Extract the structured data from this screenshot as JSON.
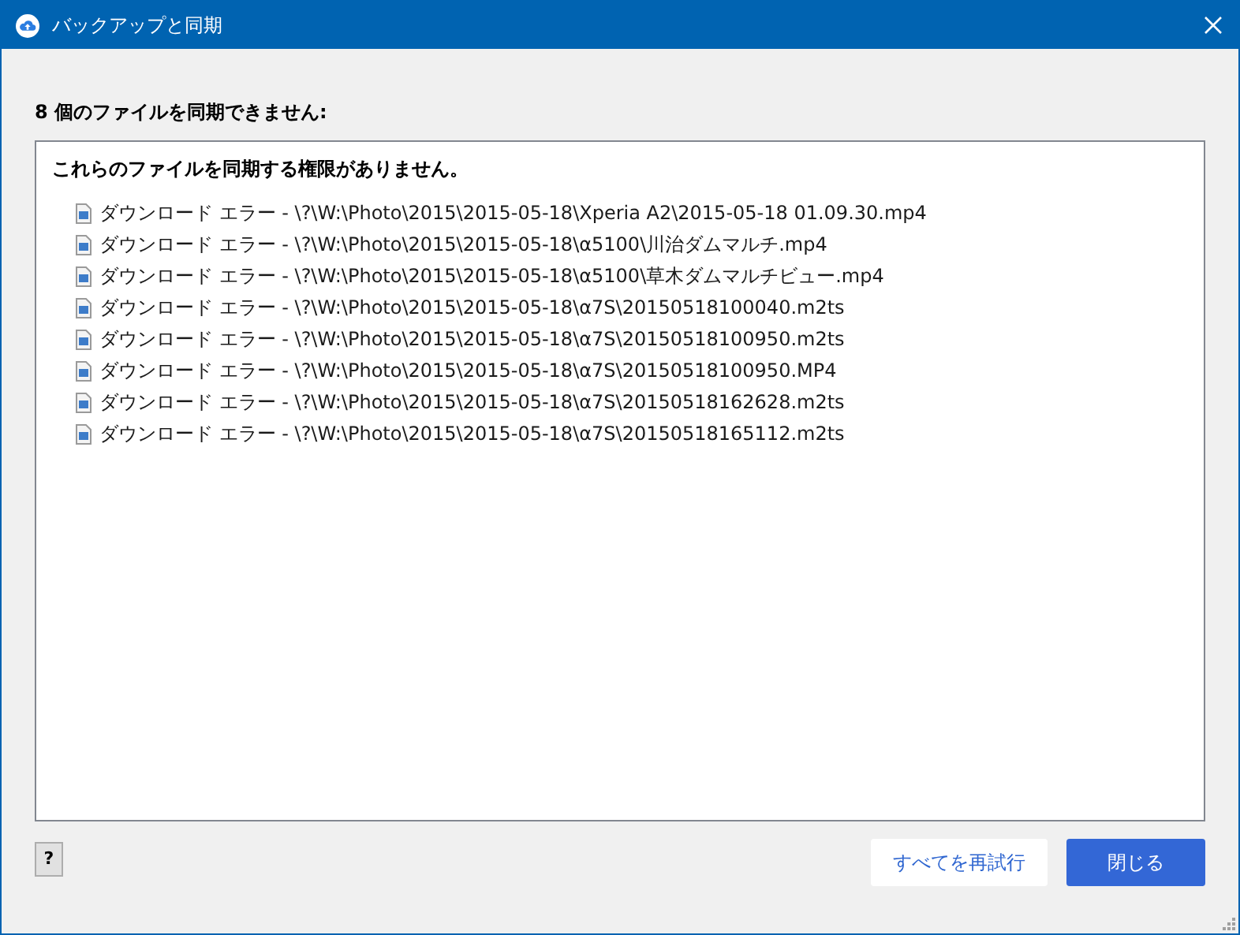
{
  "window": {
    "title": "バックアップと同期"
  },
  "heading": "8 個のファイルを同期できません:",
  "panel": {
    "message": "これらのファイルを同期する権限がありません。",
    "items": [
      "ダウンロード エラー - \\?\\W:\\Photo\\2015\\2015-05-18\\Xperia A2\\2015-05-18 01.09.30.mp4",
      "ダウンロード エラー - \\?\\W:\\Photo\\2015\\2015-05-18\\α5100\\川治ダムマルチ.mp4",
      "ダウンロード エラー - \\?\\W:\\Photo\\2015\\2015-05-18\\α5100\\草木ダムマルチビュー.mp4",
      "ダウンロード エラー - \\?\\W:\\Photo\\2015\\2015-05-18\\α7S\\20150518100040.m2ts",
      "ダウンロード エラー - \\?\\W:\\Photo\\2015\\2015-05-18\\α7S\\20150518100950.m2ts",
      "ダウンロード エラー - \\?\\W:\\Photo\\2015\\2015-05-18\\α7S\\20150518100950.MP4",
      "ダウンロード エラー - \\?\\W:\\Photo\\2015\\2015-05-18\\α7S\\20150518162628.m2ts",
      "ダウンロード エラー - \\?\\W:\\Photo\\2015\\2015-05-18\\α7S\\20150518165112.m2ts"
    ]
  },
  "help_button": "?",
  "buttons": [
    {
      "label": "すべてを再試行",
      "kind": "secondary"
    },
    {
      "label": "閉じる",
      "kind": "primary"
    }
  ]
}
